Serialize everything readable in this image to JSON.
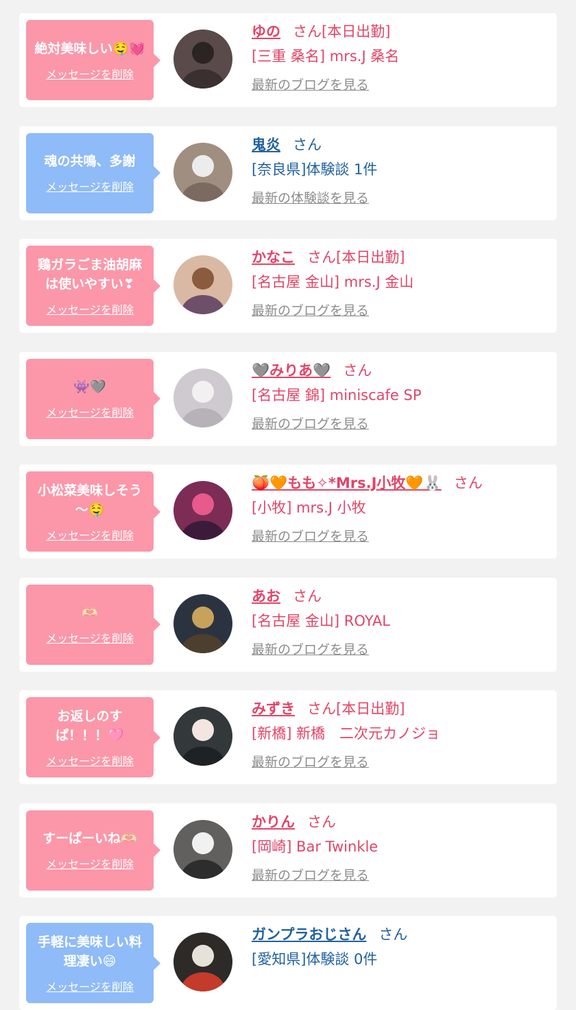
{
  "delete_label": "メッセージを削除",
  "colors": {
    "girl_bubble": "#fb97a9",
    "user_bubble": "#8fbbf8",
    "girl_text": "#e24467",
    "user_text": "#21619f",
    "link_gray": "#8c8c8c"
  },
  "cards": [
    {
      "type": "girl",
      "message": "絶対美味しい🤤💓",
      "name": "ゆの",
      "suffix": "さん[本日出勤]",
      "detail": "[三重 桑名] mrs.J 桑名",
      "link": "最新のブログを見る",
      "avatar_icon": "avatar-photo-icon"
    },
    {
      "type": "user",
      "message": "魂の共鳴、多謝",
      "name": "鬼炎",
      "suffix": "さん",
      "detail": "[奈良県]体験談 1件",
      "link": "最新の体験談を見る",
      "avatar_icon": "avatar-photo-icon"
    },
    {
      "type": "girl",
      "message": "鶏ガラごま油胡麻は使いやすい❣",
      "name": "かなこ",
      "suffix": "さん[本日出勤]",
      "detail": "[名古屋 金山] mrs.J 金山",
      "link": "最新のブログを見る",
      "avatar_icon": "avatar-photo-icon"
    },
    {
      "type": "girl",
      "message": "👾🩶",
      "name": "🩶みりあ🩶",
      "suffix": "さん",
      "detail": "[名古屋 錦] miniscafe SP",
      "link": "最新のブログを見る",
      "avatar_icon": "avatar-photo-icon"
    },
    {
      "type": "girl",
      "message": "小松菜美味しそう～🤤",
      "name": "🍑🧡もも✧*Mrs.J小牧🧡🐰",
      "suffix": "さん",
      "detail": "[小牧] mrs.J 小牧",
      "link": "最新のブログを見る",
      "avatar_icon": "avatar-photo-icon"
    },
    {
      "type": "girl",
      "message": "🫶🏻",
      "name": "あお",
      "suffix": "さん",
      "detail": "[名古屋 金山] ROYAL",
      "link": "最新のブログを見る",
      "avatar_icon": "avatar-photo-icon"
    },
    {
      "type": "girl",
      "message": "お返しのすぱ！！！🩷",
      "name": "みずき",
      "suffix": "さん[本日出勤]",
      "detail": "[新橋] 新橋　二次元カノジョ",
      "link": "最新のブログを見る",
      "avatar_icon": "avatar-photo-icon"
    },
    {
      "type": "girl",
      "message": "すーぱーいね🫶🏻",
      "name": "かりん",
      "suffix": "さん",
      "detail": "[岡崎] Bar Twinkle",
      "link": "最新のブログを見る",
      "avatar_icon": "avatar-photo-icon"
    },
    {
      "type": "user",
      "message": "手軽に美味しい料理凄い😄",
      "name": "ガンプラおじさん",
      "suffix": "さん",
      "detail": "[愛知県]体験談 0件",
      "link": "",
      "avatar_icon": "avatar-photo-icon"
    }
  ]
}
